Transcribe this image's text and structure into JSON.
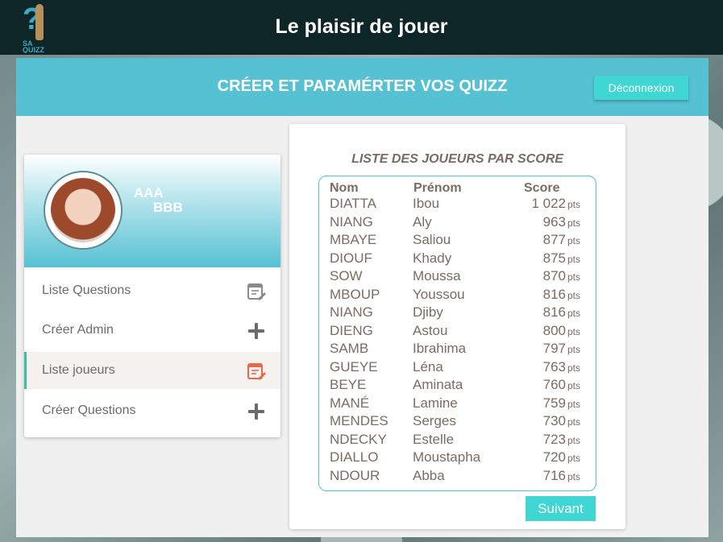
{
  "header": {
    "logo_text": "SA QUIZZ",
    "title": "Le plaisir de jouer"
  },
  "panel": {
    "title": "CRÉER ET PARAMÉRTER VOS QUIZZ",
    "logout_label": "Déconnexion"
  },
  "profile": {
    "first_name": "AAA",
    "last_name": "BBB"
  },
  "menu": {
    "items": [
      {
        "label": "Liste Questions",
        "icon": "edit-list-icon",
        "active": false
      },
      {
        "label": "Créer Admin",
        "icon": "plus-icon",
        "active": false
      },
      {
        "label": "Liste joueurs",
        "icon": "edit-list-icon",
        "active": true
      },
      {
        "label": "Créer Questions",
        "icon": "plus-icon",
        "active": false
      }
    ]
  },
  "players": {
    "title": "LISTE DES JOUEURS PAR SCORE",
    "columns": {
      "nom": "Nom",
      "prenom": "Prénom",
      "score": "Score"
    },
    "unit": "pts",
    "rows": [
      {
        "nom": "DIATTA",
        "prenom": "Ibou",
        "score": "1 022"
      },
      {
        "nom": "NIANG",
        "prenom": "Aly",
        "score": "963"
      },
      {
        "nom": "MBAYE",
        "prenom": "Saliou",
        "score": "877"
      },
      {
        "nom": "DIOUF",
        "prenom": "Khady",
        "score": "875"
      },
      {
        "nom": "SOW",
        "prenom": "Moussa",
        "score": "870"
      },
      {
        "nom": "MBOUP",
        "prenom": "Youssou",
        "score": "816"
      },
      {
        "nom": "NIANG",
        "prenom": "Djiby",
        "score": "816"
      },
      {
        "nom": "DIENG",
        "prenom": "Astou",
        "score": "800"
      },
      {
        "nom": "SAMB",
        "prenom": "Ibrahima",
        "score": "797"
      },
      {
        "nom": "GUEYE",
        "prenom": "Léna",
        "score": "763"
      },
      {
        "nom": "BEYE",
        "prenom": "Aminata",
        "score": "760"
      },
      {
        "nom": "MANÉ",
        "prenom": "Lamine",
        "score": "759"
      },
      {
        "nom": "MENDES",
        "prenom": "Serges",
        "score": "730"
      },
      {
        "nom": "NDECKY",
        "prenom": "Estelle",
        "score": "723"
      },
      {
        "nom": "DIALLO",
        "prenom": "Moustapha",
        "score": "720"
      },
      {
        "nom": "NDOUR",
        "prenom": "Abba",
        "score": "716"
      }
    ],
    "next_label": "Suivant"
  },
  "colors": {
    "topbar": "#0f2628",
    "accent": "#56c1d3",
    "button": "#3fd6d4",
    "active_icon": "#e8694a",
    "active_border": "#3bbf9c"
  }
}
